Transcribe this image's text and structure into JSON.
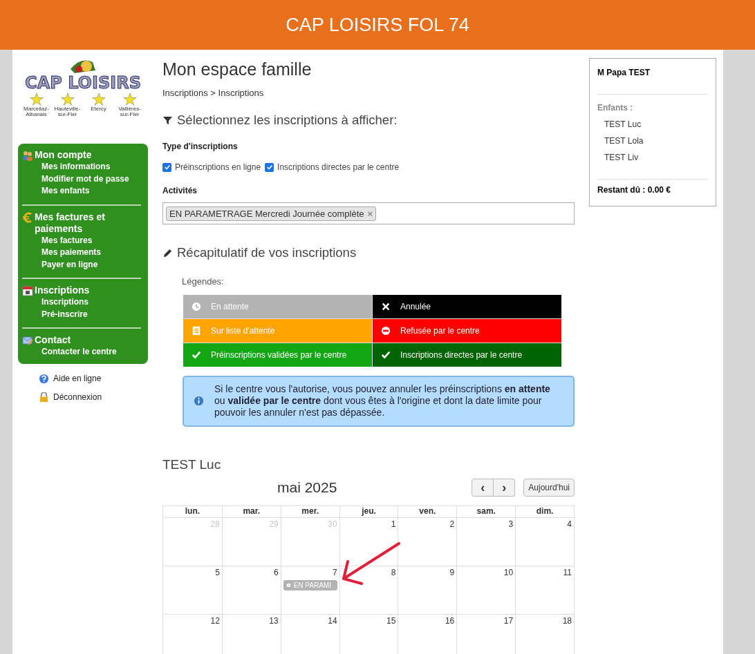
{
  "header": {
    "title": "CAP LOISIRS FOL 74"
  },
  "logo": {
    "title": "CAP LOISIRS",
    "towns": [
      "Marcellaz-Albanais",
      "Hauteville-sur-Fier",
      "Etercy",
      "Vallières-sur-Fier"
    ]
  },
  "sidebar": {
    "sections": [
      {
        "kind": "account",
        "title": "Mon compte",
        "items": [
          "Mes informations",
          "Modifier mot de passe",
          "Mes enfants"
        ]
      },
      {
        "kind": "euro",
        "title": "Mes factures et paiements",
        "items": [
          "Mes factures",
          "Mes paiements",
          "Payer en ligne"
        ]
      },
      {
        "kind": "calendar",
        "title": "Inscriptions",
        "items": [
          "Inscriptions",
          "Pré-inscrire"
        ]
      },
      {
        "kind": "mail",
        "title": "Contact",
        "items": [
          "Contacter le centre"
        ]
      }
    ],
    "links": [
      {
        "kind": "help",
        "label": "Aide en ligne"
      },
      {
        "kind": "lock",
        "label": "Déconnexion"
      }
    ]
  },
  "page": {
    "title": "Mon espace famille",
    "breadcrumb": "Inscriptions > Inscriptions",
    "filter_heading": "Sélectionnez les inscriptions à afficher:",
    "type_label": "Type d'inscriptions",
    "types": [
      {
        "label": "Préinscriptions en ligne",
        "checked": true
      },
      {
        "label": "Inscriptions directes par le centre",
        "checked": true
      }
    ],
    "activities_label": "Activités",
    "activities": [
      {
        "label": "EN PARAMETRAGE Mercredi Journée complète",
        "remove": "×"
      }
    ],
    "summary_heading": "Récapitulatif de vos inscriptions",
    "legend_label": "Légendes:",
    "legend": [
      {
        "kind": "clock",
        "label": "En attente",
        "color": "#b3b3b3"
      },
      {
        "kind": "cross",
        "label": "Annulée",
        "color": "#000000"
      },
      {
        "kind": "list",
        "label": "Sur liste d'attente",
        "color": "#ffa500"
      },
      {
        "kind": "minus",
        "label": "Refusée par le centre",
        "color": "#ff0000"
      },
      {
        "kind": "check",
        "label": "Préinscriptions validées par le centre",
        "color": "#13a813"
      },
      {
        "kind": "check",
        "label": "Inscriptions directes par le centre",
        "color": "#006400"
      }
    ],
    "info": "Si le centre vous l'autorise, vous pouvez annuler les préinscriptions **en attente** ou **validée par le centre** dont vous êtes à l'origine et dont la date limite pour pouvoir les annuler n'est pas dépassée."
  },
  "calendar": {
    "child": "TEST Luc",
    "month": "mai 2025",
    "prev": "‹",
    "next": "›",
    "today": "Aujourd'hui",
    "weekdays": [
      "lun.",
      "mar.",
      "mer.",
      "jeu.",
      "ven.",
      "sam.",
      "dim."
    ],
    "weeks": [
      [
        {
          "day": "28",
          "other_month": true
        },
        {
          "day": "29",
          "other_month": true
        },
        {
          "day": "30",
          "other_month": true
        },
        {
          "day": "1",
          "other_month": false
        },
        {
          "day": "2",
          "other_month": false
        },
        {
          "day": "3",
          "other_month": false
        },
        {
          "day": "4",
          "other_month": false
        }
      ],
      [
        {
          "day": "5",
          "other_month": false
        },
        {
          "day": "6",
          "other_month": false
        },
        {
          "day": "7",
          "other_month": false,
          "events": [
            {
              "label": "EN PARAMI",
              "color": "#b3b3b3"
            }
          ]
        },
        {
          "day": "8",
          "other_month": false
        },
        {
          "day": "9",
          "other_month": false
        },
        {
          "day": "10",
          "other_month": false
        },
        {
          "day": "11",
          "other_month": false
        }
      ],
      [
        {
          "day": "12",
          "other_month": false
        },
        {
          "day": "13",
          "other_month": false
        },
        {
          "day": "14",
          "other_month": false
        },
        {
          "day": "15",
          "other_month": false
        },
        {
          "day": "16",
          "other_month": false
        },
        {
          "day": "17",
          "other_month": false
        },
        {
          "day": "18",
          "other_month": false
        }
      ]
    ]
  },
  "account": {
    "name": "M Papa TEST",
    "children_label": "Enfants :",
    "children": [
      "TEST Luc",
      "TEST Lola",
      "TEST Liv"
    ],
    "balance": "Restant dû : 0.00 €"
  }
}
